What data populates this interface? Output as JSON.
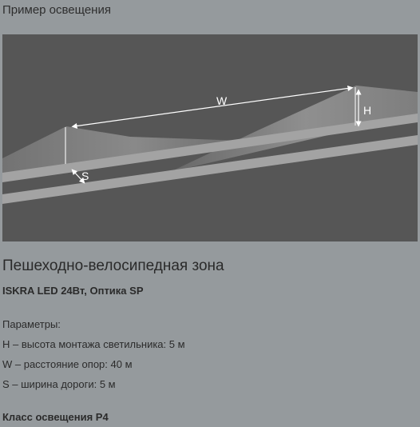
{
  "header": {
    "title": "Пример освещения"
  },
  "diagram": {
    "labels": {
      "width": "W",
      "height": "H",
      "road_width": "S"
    },
    "colors": {
      "background": "#565656",
      "road": "#a3a3a3",
      "light": "#bdbdbd"
    }
  },
  "info": {
    "zone_title": "Пешеходно-велосипедная зона",
    "product": "ISKRA LED 24Вт, Оптика SP",
    "params_heading": "Параметры:",
    "params": [
      "H – высота монтажа светильника: 5 м",
      "W – расстояние опор: 40 м",
      "S – ширина дороги: 5 м"
    ],
    "lighting_class": "Класс освещения P4"
  }
}
